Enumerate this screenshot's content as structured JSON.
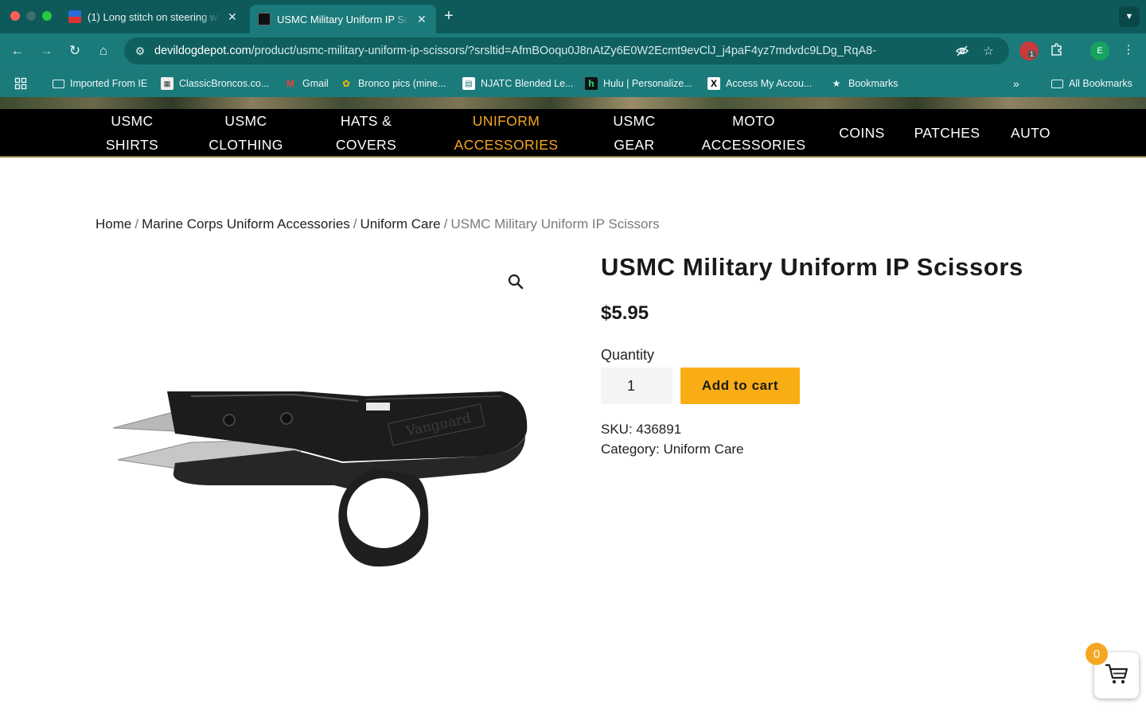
{
  "browser": {
    "tabs": [
      {
        "title": "(1) Long stitch on steering wh",
        "active": false
      },
      {
        "title": "USMC Military Uniform IP Scis",
        "active": true
      }
    ],
    "url_domain": "devildogdepot.com",
    "url_path": "/product/usmc-military-uniform-ip-scissors/?srsltid=AfmBOoqu0J8nAtZy6E0W2Ecmt9evClJ_j4paF4yz7mdvdc9LDg_RqA8-",
    "extension_badge": "1",
    "profile_initial": "E",
    "bookmarks": [
      {
        "label": "Imported From IE",
        "icon": "folder-icon"
      },
      {
        "label": "ClassicBroncos.co...",
        "icon": "site-icon"
      },
      {
        "label": "Gmail",
        "icon": "gmail-icon"
      },
      {
        "label": "Bronco pics (mine...",
        "icon": "photos-icon"
      },
      {
        "label": "NJATC Blended Le...",
        "icon": "site-icon"
      },
      {
        "label": "Hulu | Personalize...",
        "icon": "hulu-icon"
      },
      {
        "label": "Access My Accou...",
        "icon": "x-icon"
      },
      {
        "label": "Bookmarks",
        "icon": "star-icon"
      }
    ],
    "all_bookmarks": "All Bookmarks"
  },
  "nav": [
    {
      "line1": "USMC",
      "line2": "SHIRTS",
      "active": false
    },
    {
      "line1": "USMC",
      "line2": "CLOTHING",
      "active": false
    },
    {
      "line1": "HATS &",
      "line2": "COVERS",
      "active": false
    },
    {
      "line1": "UNIFORM",
      "line2": "ACCESSORIES",
      "active": true
    },
    {
      "line1": "USMC",
      "line2": "GEAR",
      "active": false
    },
    {
      "line1": "MOTO",
      "line2": "ACCESSORIES",
      "active": false
    },
    {
      "line1": "COINS",
      "line2": "",
      "active": false
    },
    {
      "line1": "PATCHES",
      "line2": "",
      "active": false
    },
    {
      "line1": "AUTO",
      "line2": "",
      "active": false
    }
  ],
  "breadcrumb": {
    "home": "Home",
    "category": "Marine Corps Uniform Accessories",
    "subcategory": "Uniform Care",
    "current": "USMC Military Uniform IP Scissors",
    "separator": "/"
  },
  "product": {
    "title": "USMC Military Uniform IP Scissors",
    "price": "$5.95",
    "quantity_label": "Quantity",
    "quantity": "1",
    "add_to_cart": "Add to cart",
    "sku_label": "SKU:",
    "sku": "436891",
    "category_label": "Category:",
    "category": "Uniform Care",
    "image_brand_text": "Vanguard"
  },
  "cart": {
    "count": "0"
  },
  "colors": {
    "accent": "#f5a623",
    "button": "#f9ad14",
    "chrome": "#1b7a7a",
    "nav_bg": "#000000"
  }
}
